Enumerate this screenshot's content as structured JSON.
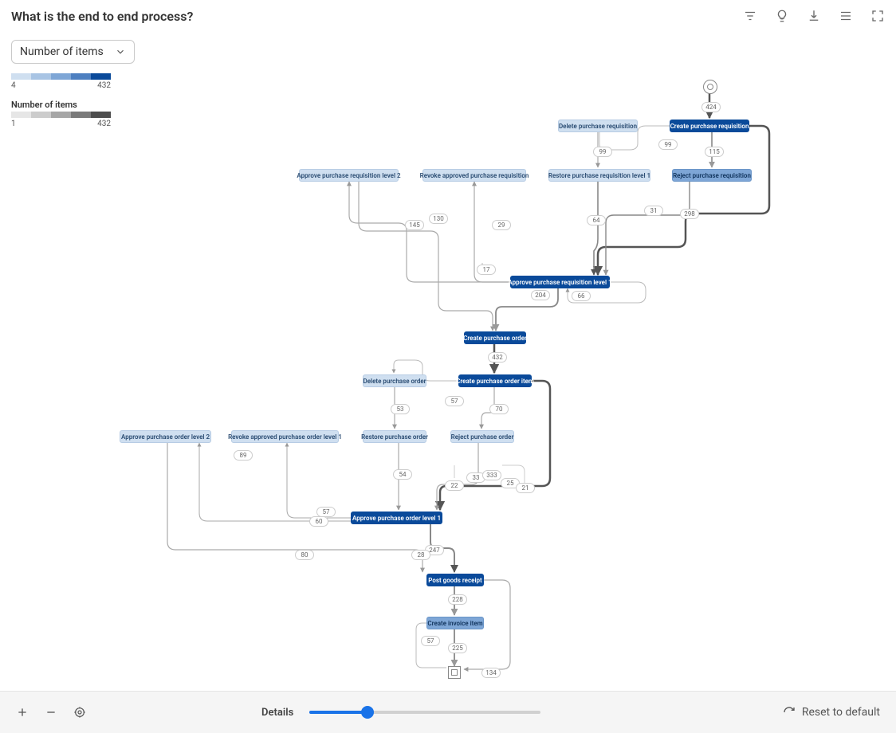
{
  "title": "What is the end to end process?",
  "dropdown": {
    "label": "Number of items"
  },
  "legend": {
    "blue": {
      "min": "4",
      "max": "432",
      "colors": [
        "#cfdff0",
        "#a8c4e4",
        "#7ea6d6",
        "#4d7fc0",
        "#0a4a9a"
      ]
    },
    "gray": {
      "label": "Number of items",
      "min": "1",
      "max": "432",
      "colors": [
        "#e6e6e6",
        "#cccccc",
        "#a6a6a6",
        "#7a7a7a",
        "#4d4d4d"
      ]
    }
  },
  "nodes": {
    "delete_pr": {
      "label": "Delete purchase requisition"
    },
    "create_pr": {
      "label": "Create purchase requisition"
    },
    "approve_pr_l2": {
      "label": "Approve purchase requisition level 2"
    },
    "revoke_pr": {
      "label": "Revoke approved purchase requisition"
    },
    "restore_pr_l1": {
      "label": "Restore purchase requisition level 1"
    },
    "reject_pr": {
      "label": "Reject purchase requisition"
    },
    "approve_pr_l1": {
      "label": "Approve purchase requisition level 1"
    },
    "create_po": {
      "label": "Create purchase order"
    },
    "delete_po": {
      "label": "Delete purchase order"
    },
    "create_po_item": {
      "label": "Create purchase order item"
    },
    "approve_po_l2": {
      "label": "Approve purchase order level 2"
    },
    "revoke_po_l1": {
      "label": "Revoke approved purchase order level 1"
    },
    "restore_po": {
      "label": "Restore purchase order"
    },
    "reject_po": {
      "label": "Reject purchase order"
    },
    "approve_po_l1": {
      "label": "Approve purchase order level 1"
    },
    "post_gr": {
      "label": "Post goods receipt"
    },
    "create_inv": {
      "label": "Create invoice item"
    }
  },
  "edges": {
    "e424": "424",
    "e99a": "99",
    "e99b": "99",
    "e115": "115",
    "e31": "31",
    "e298": "298",
    "e64": "64",
    "e145": "145",
    "e130": "130",
    "e29": "29",
    "e17": "17",
    "e204": "204",
    "e66": "66",
    "e432": "432",
    "e57a": "57",
    "e70": "70",
    "e53": "53",
    "e89": "89",
    "e54": "54",
    "e33": "33",
    "e333": "333",
    "e22": "22",
    "e25": "25",
    "e21": "21",
    "e57b": "57",
    "e60": "60",
    "e247": "247",
    "e28": "28",
    "e80": "80",
    "e228": "228",
    "e57c": "57",
    "e225": "225",
    "e134": "134"
  },
  "footer": {
    "details": "Details",
    "reset": "Reset to default"
  }
}
